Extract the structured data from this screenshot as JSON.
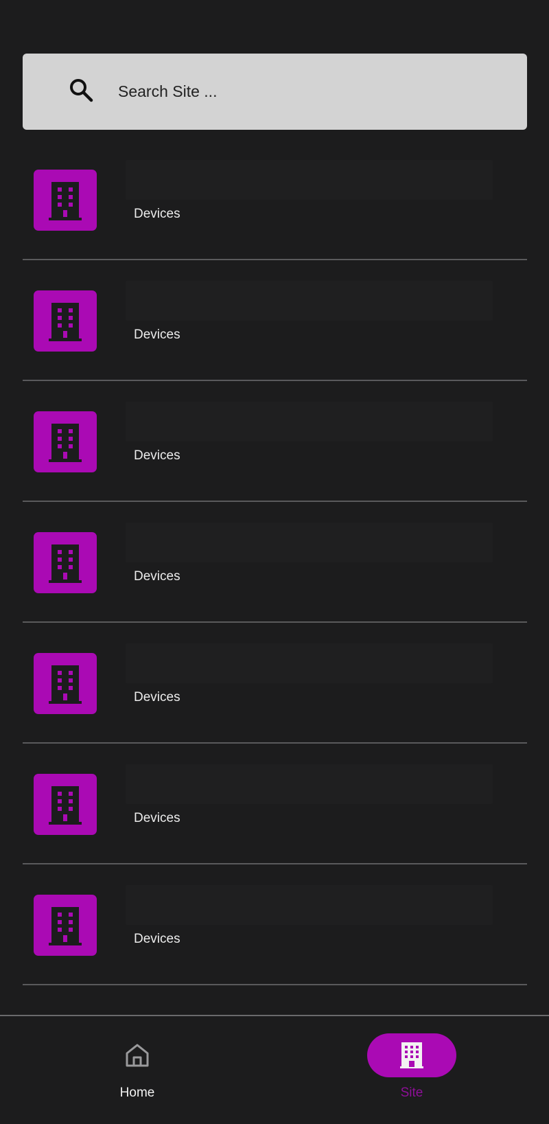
{
  "search": {
    "placeholder": "Search Site ..."
  },
  "sites": [
    {
      "subtitle": "Devices"
    },
    {
      "subtitle": "Devices"
    },
    {
      "subtitle": "Devices"
    },
    {
      "subtitle": "Devices"
    },
    {
      "subtitle": "Devices"
    },
    {
      "subtitle": "Devices"
    },
    {
      "subtitle": "Devices"
    }
  ],
  "nav": {
    "home_label": "Home",
    "site_label": "Site"
  },
  "colors": {
    "accent": "#aa0ab4",
    "background": "#1c1c1d",
    "search_background": "#d3d3d3",
    "active_nav_label": "#8e0f98"
  },
  "icons": {
    "search": "search-icon",
    "site_tile": "building-icon",
    "home": "home-icon",
    "site_nav": "building-icon"
  }
}
